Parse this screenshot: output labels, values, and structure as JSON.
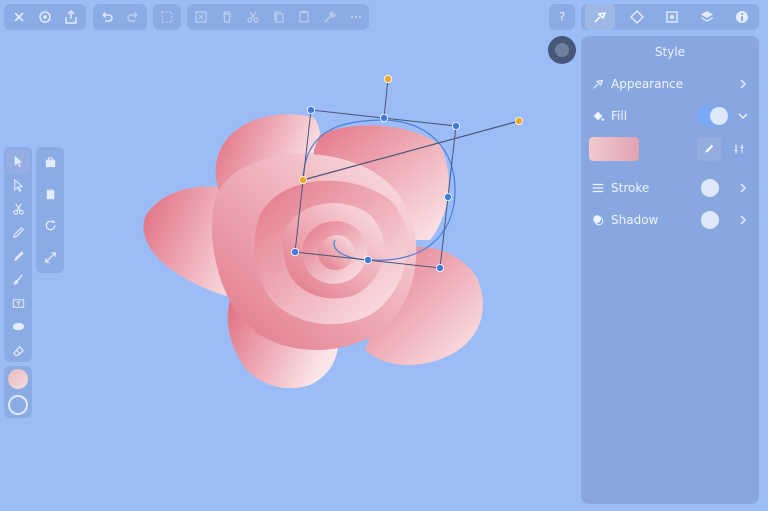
{
  "toolbar": {
    "groups": [
      [
        "close-icon",
        "settings-icon",
        "share-icon"
      ],
      [
        "undo-icon",
        "redo-icon"
      ],
      [
        "zoom-icon"
      ],
      [
        "select-icon",
        "delete-icon",
        "cut-icon",
        "copy-icon",
        "paste-icon",
        "pick-icon",
        "more-icon"
      ]
    ],
    "help_label": "?"
  },
  "tabs": [
    "style-tab-icon",
    "shape-tab-icon",
    "image-tab-icon",
    "layers-tab-icon",
    "info-tab-icon"
  ],
  "style_panel": {
    "title": "Style",
    "appearance_label": "Appearance",
    "fill_label": "Fill",
    "stroke_label": "Stroke",
    "shadow_label": "Shadow",
    "fill_color_start": "#f2c9cf",
    "fill_color_end": "#dfa3b3"
  },
  "colors": {
    "canvas": "#9bbcf7",
    "rose_dark": "#e06b7e",
    "rose_light": "#fbe6e9",
    "handle_blue": "#3f7ae0",
    "handle_orange": "#f5a623"
  }
}
